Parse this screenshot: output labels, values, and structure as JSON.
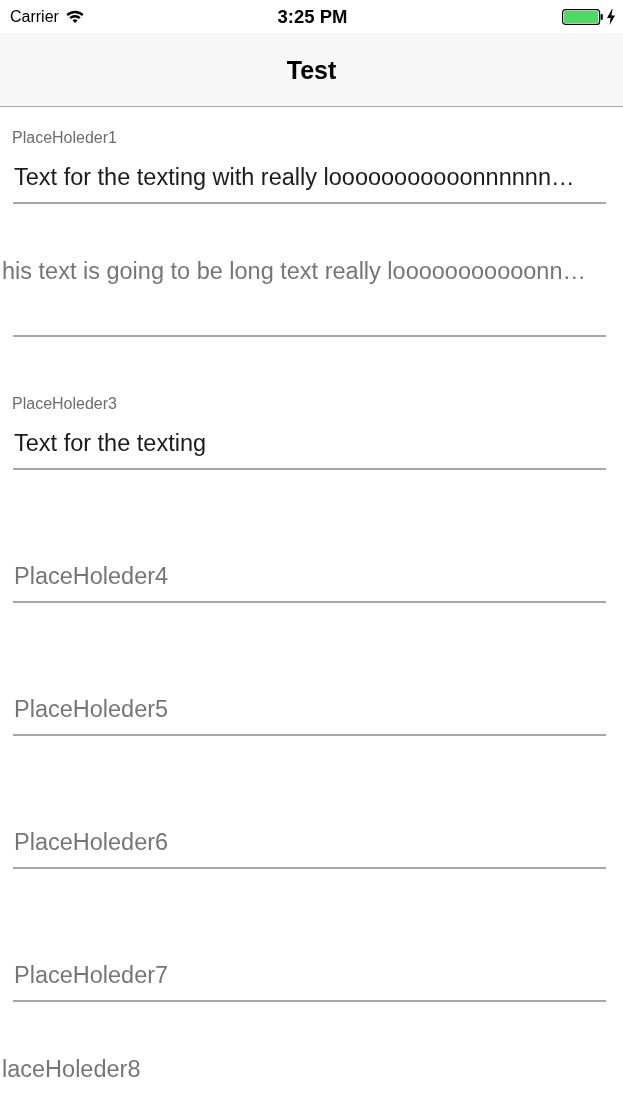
{
  "status_bar": {
    "carrier": "Carrier",
    "time": "3:25 PM"
  },
  "nav_bar": {
    "title": "Test"
  },
  "fields": [
    {
      "kind": "filled",
      "placeholder": "PlaceHoleder1",
      "value": "Text for the texting with really looooooooooonnnnnn…"
    },
    {
      "kind": "raised",
      "placeholder": "his text is going to be long text really looooooooooonn…"
    },
    {
      "kind": "filled",
      "placeholder": "PlaceHoleder3",
      "value": "Text for the texting"
    },
    {
      "kind": "empty",
      "placeholder": "PlaceHoleder4"
    },
    {
      "kind": "empty",
      "placeholder": "PlaceHoleder5"
    },
    {
      "kind": "empty",
      "placeholder": "PlaceHoleder6"
    },
    {
      "kind": "empty",
      "placeholder": "PlaceHoleder7"
    },
    {
      "kind": "clipped",
      "placeholder": "laceHoleder8"
    }
  ]
}
